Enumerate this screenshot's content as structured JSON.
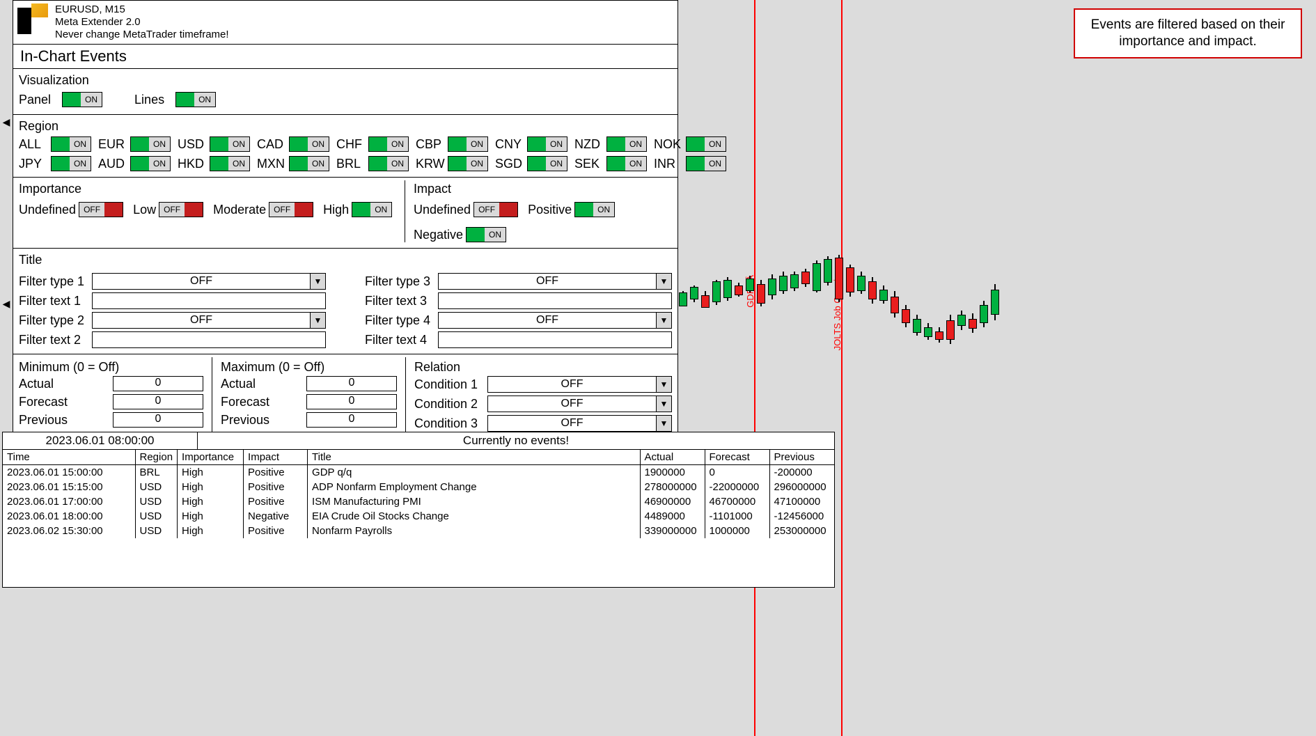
{
  "header": {
    "symbol": "EURUSD, M15",
    "product": "Meta Extender 2.0",
    "warn": "Never change MetaTrader timeframe!"
  },
  "panel_title": "In-Chart Events",
  "viz": {
    "title": "Visualization",
    "panel_label": "Panel",
    "panel_state": "on",
    "lines_label": "Lines",
    "lines_state": "on"
  },
  "region": {
    "title": "Region",
    "items": [
      {
        "label": "ALL",
        "state": "on"
      },
      {
        "label": "EUR",
        "state": "on"
      },
      {
        "label": "USD",
        "state": "on"
      },
      {
        "label": "CAD",
        "state": "on"
      },
      {
        "label": "CHF",
        "state": "on"
      },
      {
        "label": "CBP",
        "state": "on"
      },
      {
        "label": "CNY",
        "state": "on"
      },
      {
        "label": "NZD",
        "state": "on"
      },
      {
        "label": "NOK",
        "state": "on"
      },
      {
        "label": "JPY",
        "state": "on"
      },
      {
        "label": "AUD",
        "state": "on"
      },
      {
        "label": "HKD",
        "state": "on"
      },
      {
        "label": "MXN",
        "state": "on"
      },
      {
        "label": "BRL",
        "state": "on"
      },
      {
        "label": "KRW",
        "state": "on"
      },
      {
        "label": "SGD",
        "state": "on"
      },
      {
        "label": "SEK",
        "state": "on"
      },
      {
        "label": "INR",
        "state": "on"
      }
    ]
  },
  "importance": {
    "title": "Importance",
    "items": [
      {
        "label": "Undefined",
        "state": "off"
      },
      {
        "label": "Low",
        "state": "off"
      },
      {
        "label": "Moderate",
        "state": "off"
      },
      {
        "label": "High",
        "state": "on"
      }
    ]
  },
  "impact": {
    "title": "Impact",
    "items": [
      {
        "label": "Undefined",
        "state": "off"
      },
      {
        "label": "Positive",
        "state": "on"
      },
      {
        "label": "Negative",
        "state": "on"
      }
    ]
  },
  "titlefilt": {
    "title": "Title",
    "rows": [
      {
        "type_label": "Filter type 1",
        "type_val": "OFF",
        "text_label": "Filter text 1",
        "text_val": ""
      },
      {
        "type_label": "Filter type 2",
        "type_val": "OFF",
        "text_label": "Filter text 2",
        "text_val": ""
      },
      {
        "type_label": "Filter type 3",
        "type_val": "OFF",
        "text_label": "Filter text 3",
        "text_val": ""
      },
      {
        "type_label": "Filter type 4",
        "type_val": "OFF",
        "text_label": "Filter text 4",
        "text_val": ""
      }
    ]
  },
  "min": {
    "title": "Minimum (0 = Off)",
    "actual_label": "Actual",
    "actual": "0",
    "forecast_label": "Forecast",
    "forecast": "0",
    "prev_label": "Previous",
    "prev": "0"
  },
  "max": {
    "title": "Maximum (0 = Off)",
    "actual_label": "Actual",
    "actual": "0",
    "forecast_label": "Forecast",
    "forecast": "0",
    "prev_label": "Previous",
    "prev": "0"
  },
  "rel": {
    "title": "Relation",
    "c1_label": "Condition 1",
    "c1": "OFF",
    "c2_label": "Condition 2",
    "c2": "OFF",
    "c3_label": "Condition 3",
    "c3": "OFF"
  },
  "callout": "Events are filtered based on their importance and impact.",
  "chart_labels": {
    "l1": "GDP yĀ",
    "l2": "JOLTS Job Openings"
  },
  "events": {
    "current_ts": "2023.06.01 08:00:00",
    "status": "Currently no events!",
    "cols": [
      "Time",
      "Region",
      "Importance",
      "Impact",
      "Title",
      "Actual",
      "Forecast",
      "Previous"
    ],
    "rows": [
      {
        "time": "2023.06.01 15:00:00",
        "region": "BRL",
        "imp": "High",
        "impact": "Positive",
        "title": "GDP q/q",
        "actual": "1900000",
        "forecast": "0",
        "prev": "-200000"
      },
      {
        "time": "2023.06.01 15:15:00",
        "region": "USD",
        "imp": "High",
        "impact": "Positive",
        "title": "ADP Nonfarm Employment Change",
        "actual": "278000000",
        "forecast": "-22000000",
        "prev": "296000000"
      },
      {
        "time": "2023.06.01 17:00:00",
        "region": "USD",
        "imp": "High",
        "impact": "Positive",
        "title": "ISM Manufacturing PMI",
        "actual": "46900000",
        "forecast": "46700000",
        "prev": "47100000"
      },
      {
        "time": "2023.06.01 18:00:00",
        "region": "USD",
        "imp": "High",
        "impact": "Negative",
        "title": "EIA Crude Oil Stocks Change",
        "actual": "4489000",
        "forecast": "-1101000",
        "prev": "-12456000"
      },
      {
        "time": "2023.06.02 15:30:00",
        "region": "USD",
        "imp": "High",
        "impact": "Positive",
        "title": "Nonfarm Payrolls",
        "actual": "339000000",
        "forecast": "1000000",
        "prev": "253000000"
      }
    ]
  },
  "on_text": "on",
  "off_text": "off"
}
